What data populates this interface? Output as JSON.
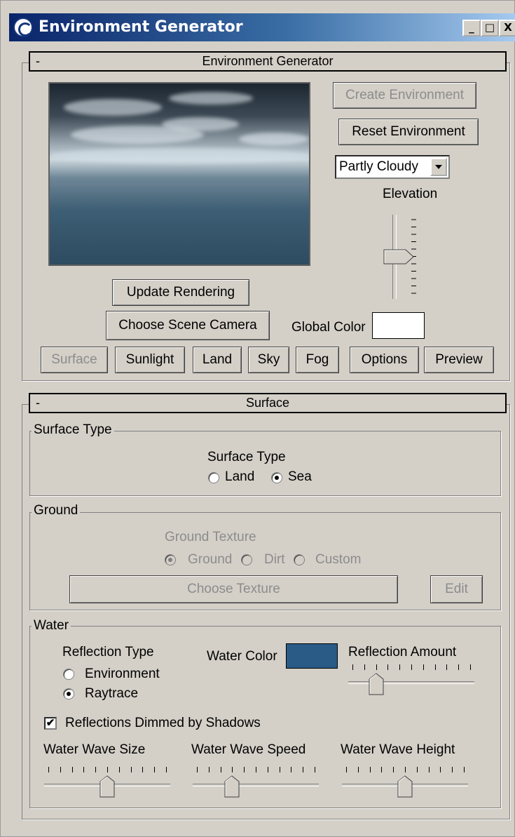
{
  "window": {
    "title": "Environment Generator",
    "minimize": "_",
    "restore": "□",
    "close": "X"
  },
  "env_rollout": {
    "title": "Environment Generator",
    "collapse": "-",
    "create_btn": "Create Environment",
    "reset_btn": "Reset Environment",
    "preset_value": "Partly Cloudy",
    "elevation_label": "Elevation",
    "elevation_level": 0.5,
    "update_btn": "Update Rendering",
    "camera_btn": "Choose Scene Camera",
    "global_color_label": "Global Color",
    "global_color": "#ffffff",
    "tabs": [
      "Surface",
      "Sunlight",
      "Land",
      "Sky",
      "Fog",
      "Options",
      "Preview"
    ]
  },
  "surface_rollout": {
    "title": "Surface",
    "collapse": "-",
    "surface_type_group": "Surface Type",
    "surface_type_label": "Surface Type",
    "surface_options": [
      "Land",
      "Sea"
    ],
    "surface_selected": "Sea",
    "ground_group": "Ground",
    "ground_texture_label": "Ground Texture",
    "ground_options": [
      "Ground",
      "Dirt",
      "Custom"
    ],
    "ground_selected": "Ground",
    "choose_texture_btn": "Choose Texture",
    "edit_btn": "Edit",
    "water_group": "Water",
    "reflection_type_label": "Reflection Type",
    "reflection_options": [
      "Environment",
      "Raytrace"
    ],
    "reflection_selected": "Raytrace",
    "water_color_label": "Water Color",
    "water_color": "#2a5a86",
    "reflection_amount_label": "Reflection Amount",
    "reflection_amount": 0.2,
    "dimmed_label": "Reflections Dimmed by Shadows",
    "dimmed_checked": true,
    "wave_size_label": "Water Wave Size",
    "wave_size": 0.5,
    "wave_speed_label": "Water Wave Speed",
    "wave_speed": 0.3,
    "wave_height_label": "Water Wave Height",
    "wave_height": 0.5
  },
  "colors": {
    "panel": "#d4d0c8",
    "title_start": "#0a246a",
    "title_end": "#a6caf0"
  }
}
